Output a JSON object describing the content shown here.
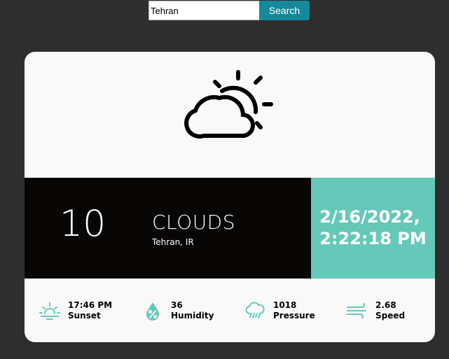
{
  "search": {
    "value": "Tehran",
    "button_label": "Search"
  },
  "weather": {
    "icon": "partly-cloudy-icon",
    "temperature": "10",
    "condition": "CLOUDS",
    "location": "Tehran, IR",
    "date": "2/16/2022,",
    "time": "2:22:18 PM"
  },
  "stats": [
    {
      "icon": "sunset-icon",
      "value": "17:46 PM",
      "label": "Sunset"
    },
    {
      "icon": "humidity-icon",
      "value": "36",
      "label": "Humidity"
    },
    {
      "icon": "pressure-icon",
      "value": "1018",
      "label": "Pressure"
    },
    {
      "icon": "wind-icon",
      "value": "2.68",
      "label": "Speed"
    }
  ],
  "colors": {
    "background": "#2e2e2e",
    "accent": "#66c8b8",
    "button": "#13899a",
    "dark_band": "#080605",
    "card": "#f9f9f9"
  }
}
